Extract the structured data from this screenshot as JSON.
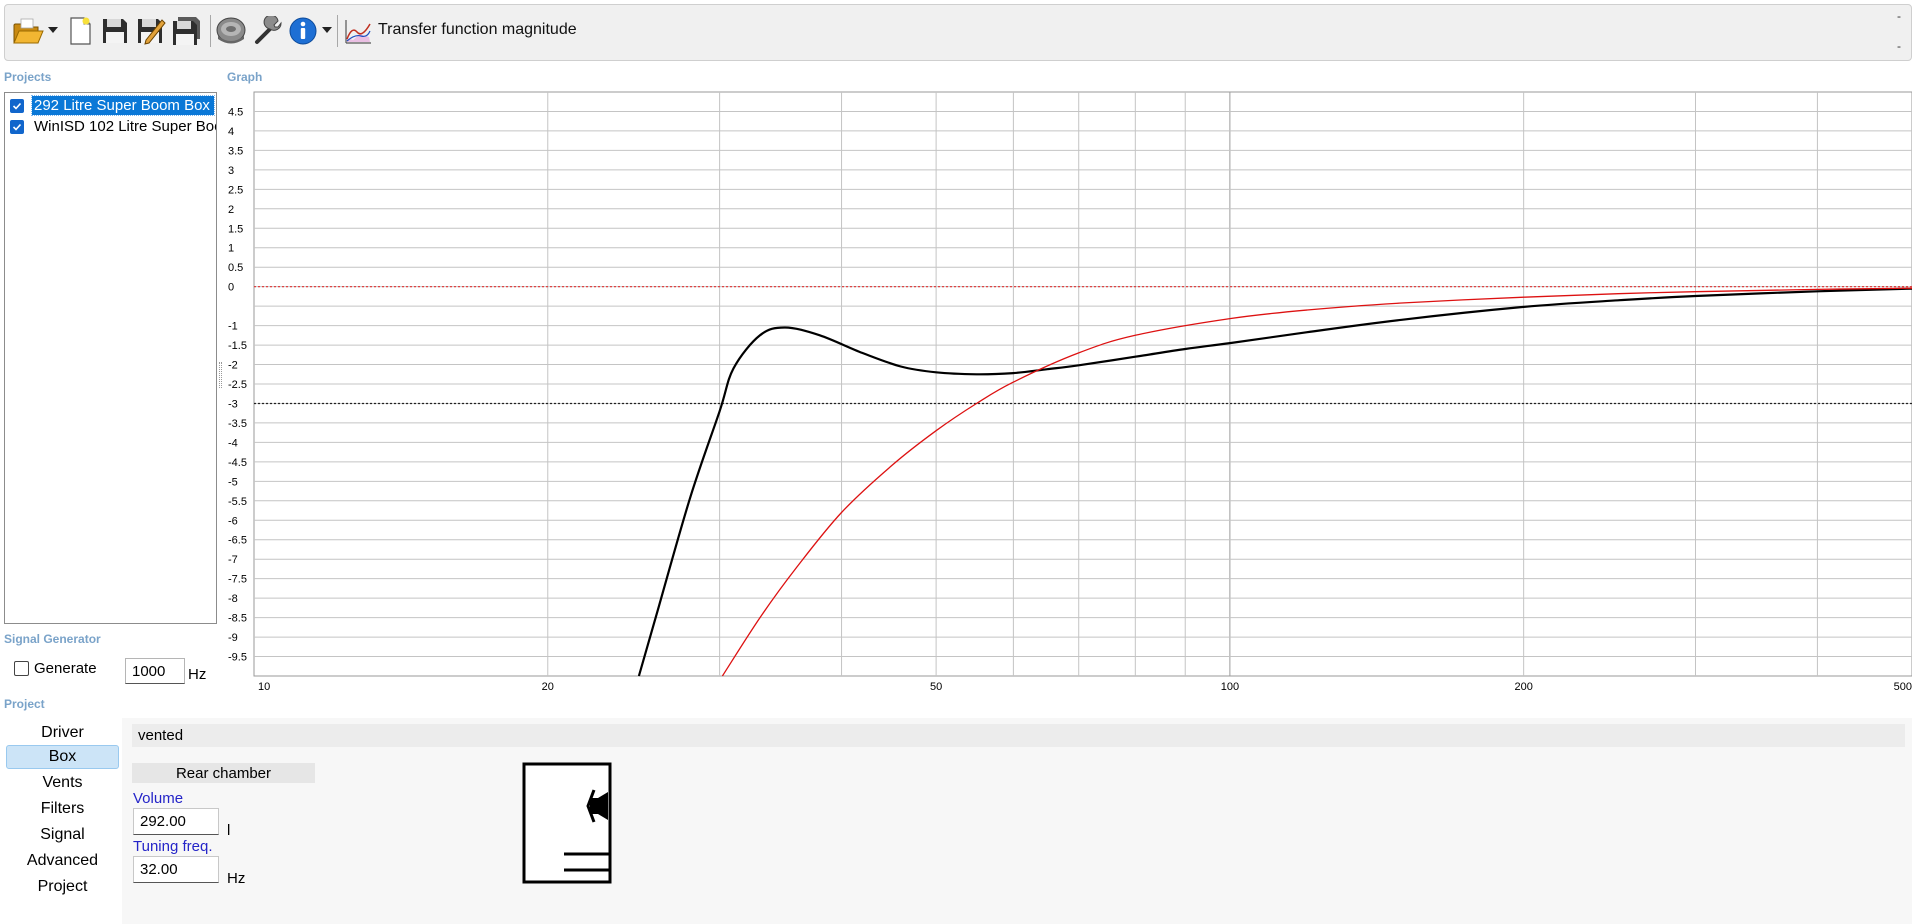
{
  "toolbar": {
    "title": "Transfer function magnitude",
    "buttons": [
      {
        "name": "open-folder-icon"
      },
      {
        "name": "new-document-icon"
      },
      {
        "name": "save-icon"
      },
      {
        "name": "save-as-icon"
      },
      {
        "name": "save-all-icon"
      },
      {
        "name": "driver-speaker-icon"
      },
      {
        "name": "tools-wrench-icon"
      },
      {
        "name": "info-icon"
      }
    ],
    "graph_icon": "graph-chart-icon",
    "dash_top": "-",
    "dash_bottom": "-"
  },
  "projects": {
    "label": "Projects",
    "items": [
      {
        "label": "292 Litre Super Boom Box",
        "checked": true,
        "selected": true
      },
      {
        "label": "WinISD 102 Litre Super Boo",
        "checked": true,
        "selected": false
      }
    ]
  },
  "graph": {
    "label": "Graph"
  },
  "signal_generator": {
    "label": "Signal Generator",
    "generate_label": "Generate",
    "generate_checked": false,
    "frequency": "1000",
    "unit": "Hz"
  },
  "project": {
    "label": "Project",
    "nav": [
      {
        "label": "Driver",
        "active": false
      },
      {
        "label": "Box",
        "active": true
      },
      {
        "label": "Vents",
        "active": false
      },
      {
        "label": "Filters",
        "active": false
      },
      {
        "label": "Signal",
        "active": false
      },
      {
        "label": "Advanced",
        "active": false
      },
      {
        "label": "Project",
        "active": false
      }
    ],
    "box_type": "vented",
    "chamber_label": "Rear chamber",
    "volume_label": "Volume",
    "volume_value": "292.00",
    "volume_unit": "l",
    "tuning_label": "Tuning freq.",
    "tuning_value": "32.00",
    "tuning_unit": "Hz"
  },
  "chart_data": {
    "type": "line",
    "x_scale": "log",
    "xlim": [
      10,
      500
    ],
    "ylim": [
      -10,
      5
    ],
    "x_ticks": [
      10,
      20,
      50,
      100,
      200,
      500
    ],
    "x_tick_labels": [
      "10",
      "20",
      "50",
      "100",
      "200",
      "500"
    ],
    "y_ticks": [
      4.5,
      4,
      3.5,
      3,
      2.5,
      2,
      1.5,
      1,
      0.5,
      0,
      -1,
      -1.5,
      -2,
      -2.5,
      -3,
      -3.5,
      -4,
      -4.5,
      -5,
      -5.5,
      -6,
      -6.5,
      -7,
      -7.5,
      -8,
      -8.5,
      -9,
      -9.5
    ],
    "y_tick_labels": [
      "4.5",
      "4",
      "3.5",
      "3",
      "2.5",
      "2",
      "1.5",
      "1",
      "0.5",
      "0",
      "-1",
      "-1.5",
      "-2",
      "-2.5",
      "-3",
      "-3.5",
      "-4",
      "-4.5",
      "-5",
      "-5.5",
      "-6",
      "-6.5",
      "-7",
      "-7.5",
      "-8",
      "-8.5",
      "-9",
      "-9.5"
    ],
    "grid": true,
    "reference_lines": [
      {
        "y": 0,
        "color": "#e03030",
        "style": "dotted"
      },
      {
        "y": -3,
        "color": "#222222",
        "style": "dotted"
      }
    ],
    "series": [
      {
        "color": "#000000",
        "x": [
          24.8,
          26,
          28,
          30,
          31,
          33,
          35,
          38,
          42,
          46,
          50,
          55,
          60,
          65,
          70,
          80,
          90,
          100,
          120,
          150,
          200,
          250,
          300,
          400,
          500
        ],
        "y": [
          -10,
          -8.2,
          -5.4,
          -3.2,
          -2.1,
          -1.25,
          -1.05,
          -1.25,
          -1.7,
          -2.05,
          -2.2,
          -2.25,
          -2.22,
          -2.12,
          -2.02,
          -1.8,
          -1.6,
          -1.45,
          -1.17,
          -0.85,
          -0.52,
          -0.35,
          -0.24,
          -0.12,
          -0.05
        ]
      },
      {
        "color": "#dd1111",
        "x": [
          30.2,
          33,
          36,
          40,
          45,
          50,
          55,
          60,
          70,
          80,
          100,
          120,
          150,
          200,
          250,
          300,
          400,
          500
        ],
        "y": [
          -10,
          -8.5,
          -7.2,
          -5.8,
          -4.6,
          -3.7,
          -3,
          -2.45,
          -1.7,
          -1.25,
          -0.82,
          -0.6,
          -0.42,
          -0.27,
          -0.18,
          -0.13,
          -0.07,
          -0.04
        ]
      }
    ]
  }
}
